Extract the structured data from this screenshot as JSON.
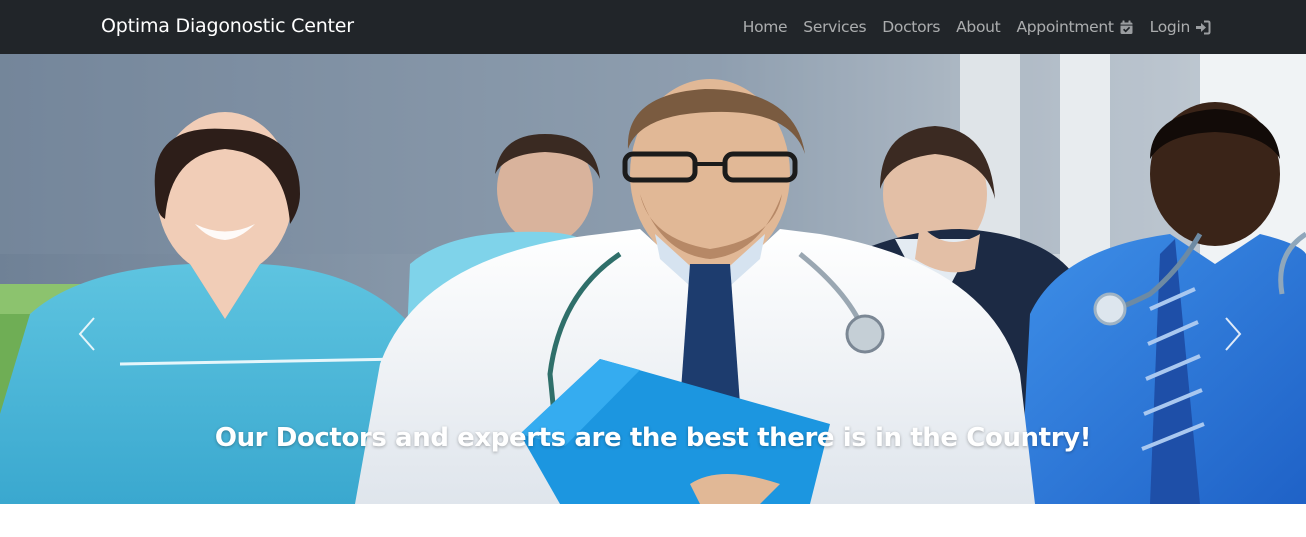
{
  "brand": "Optima Diagonostic Center",
  "nav": {
    "home": "Home",
    "services": "Services",
    "doctors": "Doctors",
    "about": "About",
    "appointment": "Appointment",
    "appointment_icon": "calendar-check-icon",
    "login": "Login",
    "login_icon": "sign-in-icon"
  },
  "carousel": {
    "caption": "Our Doctors and experts are the best there is in the Country!",
    "prev_icon": "chevron-left-icon",
    "next_icon": "chevron-right-icon"
  },
  "colors": {
    "navbar_bg": "#212529",
    "nav_link": "#9a9da0",
    "brand_text": "#ffffff"
  }
}
